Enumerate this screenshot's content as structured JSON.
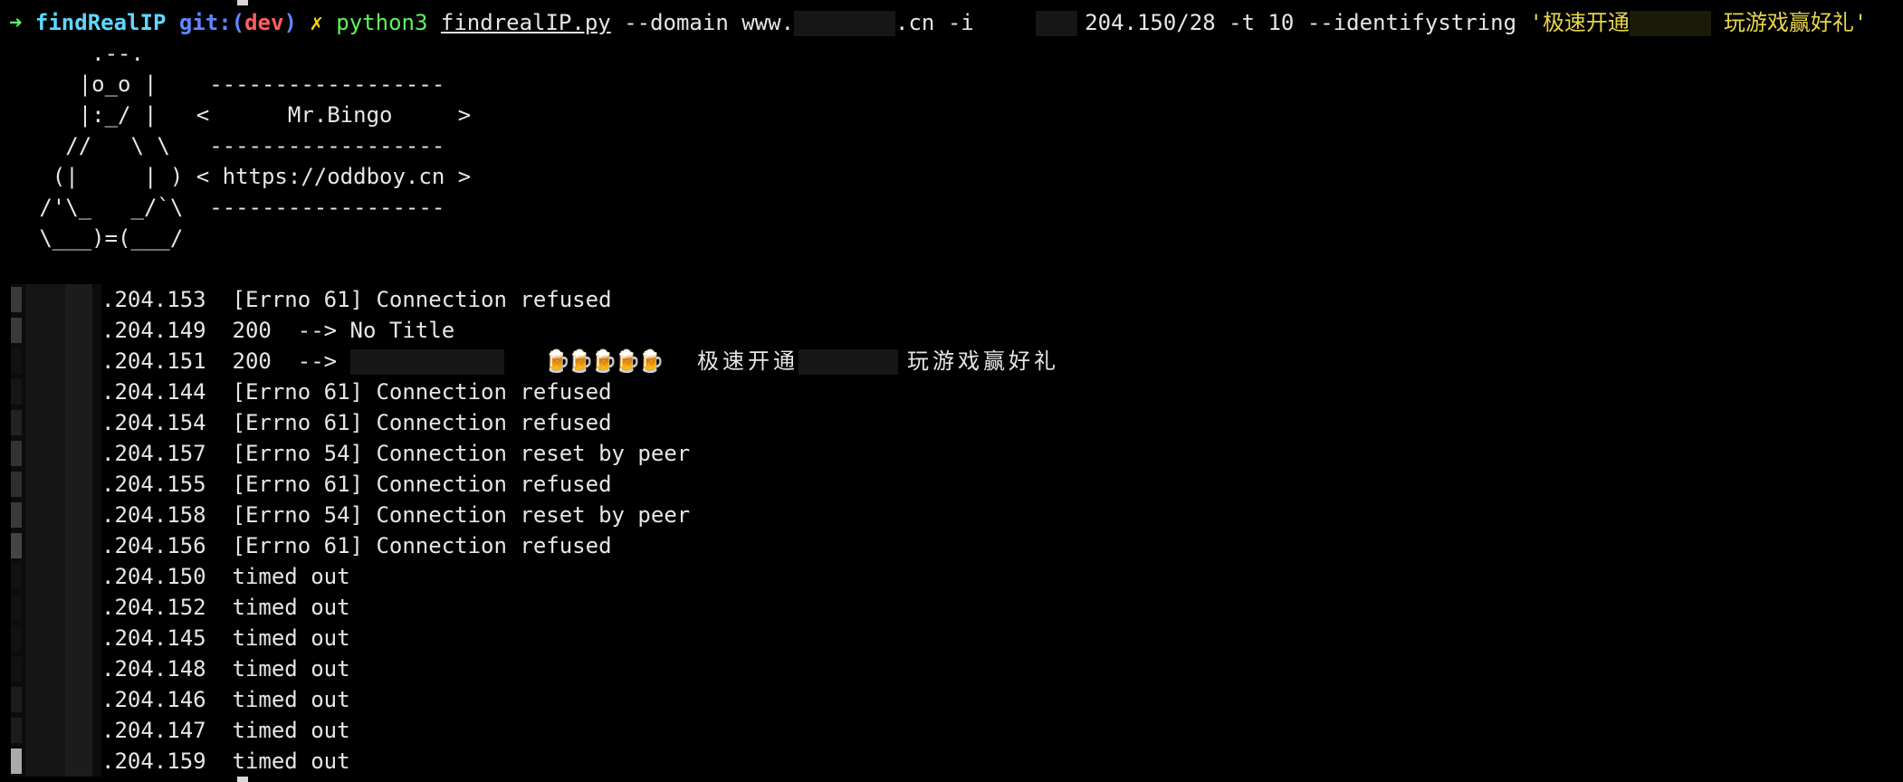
{
  "prompt": {
    "arrow": "➜",
    "cwd": "findRealIP",
    "git_label": "git:(",
    "branch": "dev",
    "git_close": ")",
    "dirty_mark": "✗",
    "command": "python3",
    "script": "findrealIP.py",
    "args_1": "--domain www.",
    "args_2": ".cn -i ",
    "args_3": "204.150/28 -t 10 --identifystring ",
    "quote_open": "'极速开通",
    "quote_close": "玩游戏赢好礼'"
  },
  "banner": [
    "       .--.",
    "      |o_o |    ------------------",
    "      |:_/ |   <      Mr.Bingo     >",
    "     //   \\ \\   ------------------",
    "    (|     | ) < https://oddboy.cn >",
    "   /'\\_   _/`\\  ------------------",
    "   \\___)=(___/"
  ],
  "results": [
    {
      "ip": ".204.153",
      "msg": "[Errno 61] Connection refused"
    },
    {
      "ip": ".204.149",
      "msg": "200  --> No Title"
    },
    {
      "ip": ".204.151",
      "msg": "200  --> ",
      "beers": "🍺🍺🍺🍺🍺",
      "title_a": "极速开通",
      "title_b": "玩游戏赢好礼"
    },
    {
      "ip": ".204.144",
      "msg": "[Errno 61] Connection refused"
    },
    {
      "ip": ".204.154",
      "msg": "[Errno 61] Connection refused"
    },
    {
      "ip": ".204.157",
      "msg": "[Errno 54] Connection reset by peer"
    },
    {
      "ip": ".204.155",
      "msg": "[Errno 61] Connection refused"
    },
    {
      "ip": ".204.158",
      "msg": "[Errno 54] Connection reset by peer"
    },
    {
      "ip": ".204.156",
      "msg": "[Errno 61] Connection refused"
    },
    {
      "ip": ".204.150",
      "msg": "timed out"
    },
    {
      "ip": ".204.152",
      "msg": "timed out"
    },
    {
      "ip": ".204.145",
      "msg": "timed out"
    },
    {
      "ip": ".204.148",
      "msg": "timed out"
    },
    {
      "ip": ".204.146",
      "msg": "timed out"
    },
    {
      "ip": ".204.147",
      "msg": "timed out"
    },
    {
      "ip": ".204.159",
      "msg": "timed out"
    }
  ],
  "colors": {
    "background": "#000000",
    "prompt_arrow": "#5ff25f",
    "cwd": "#5fd7ff",
    "branch": "#ff5f5f",
    "identify_string": "#e8d64a"
  }
}
